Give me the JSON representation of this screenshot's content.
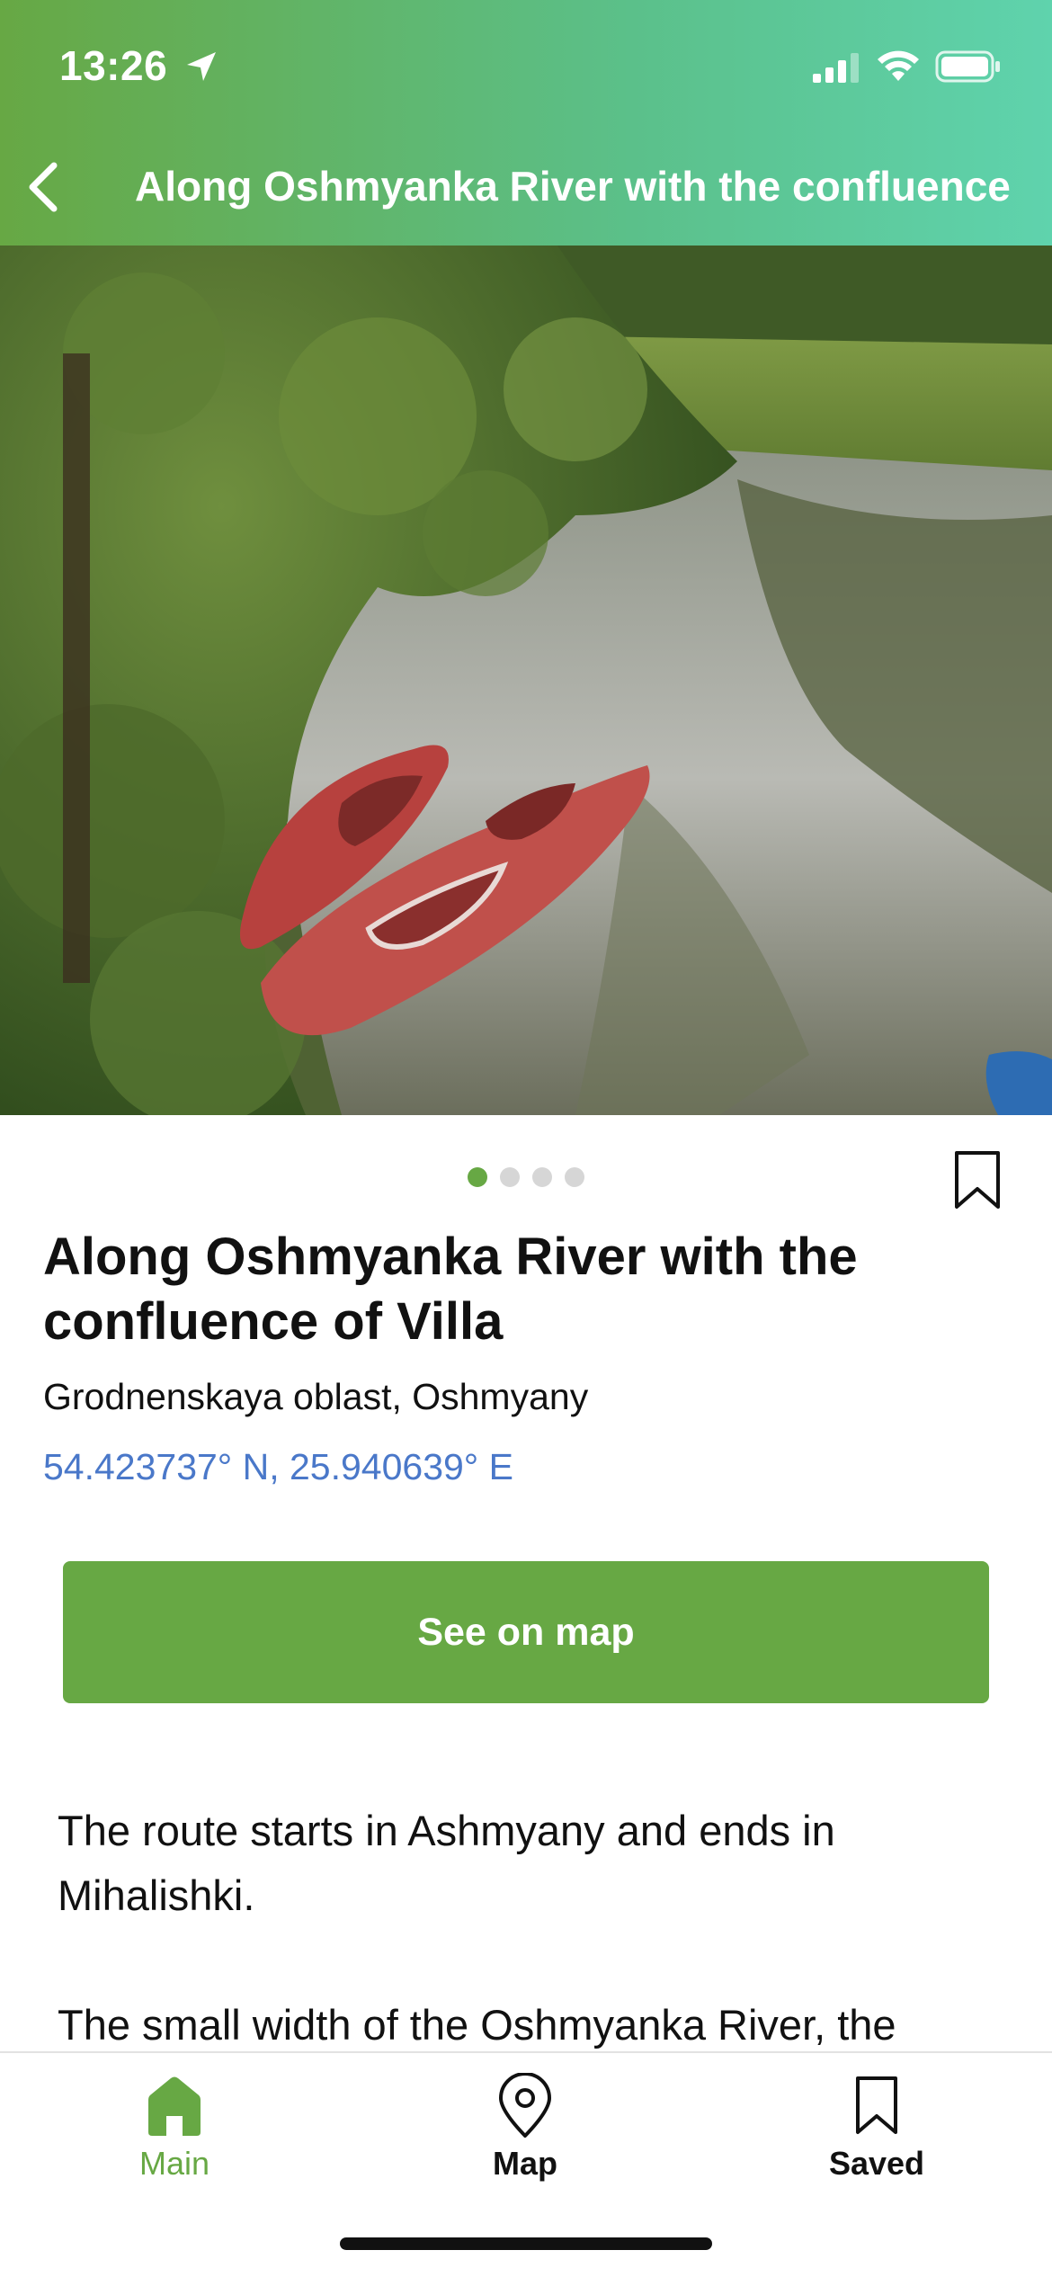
{
  "status_bar": {
    "time": "13:26"
  },
  "header": {
    "title": "Along Oshmyanka River with the confluence"
  },
  "hero": {
    "image_description_icon": "photo-kayaks-on-river",
    "page_count": 4,
    "active_page": 1
  },
  "place": {
    "title": "Along Oshmyanka River with the confluence of Villa",
    "region": "Grodnenskaya oblast, Oshmyany",
    "coordinates": "54.423737° N, 25.940639° E"
  },
  "actions": {
    "see_on_map_label": "See on map"
  },
  "description": {
    "paragraphs": [
      "The route starts in Ashmyany and ends in Mihalishki.",
      "The small width of the Oshmyanka River, the"
    ]
  },
  "tabbar": {
    "tabs": [
      {
        "label": "Main",
        "icon": "home-icon",
        "active": true
      },
      {
        "label": "Map",
        "icon": "map-pin-icon",
        "active": false
      },
      {
        "label": "Saved",
        "icon": "bookmark-icon",
        "active": false
      }
    ]
  },
  "colors": {
    "accent_green": "#67a844",
    "header_gradient_start": "#67a844",
    "header_gradient_end": "#5fd3ad",
    "link_blue": "#4a78c9",
    "inactive_dot": "#d6d6d6"
  }
}
